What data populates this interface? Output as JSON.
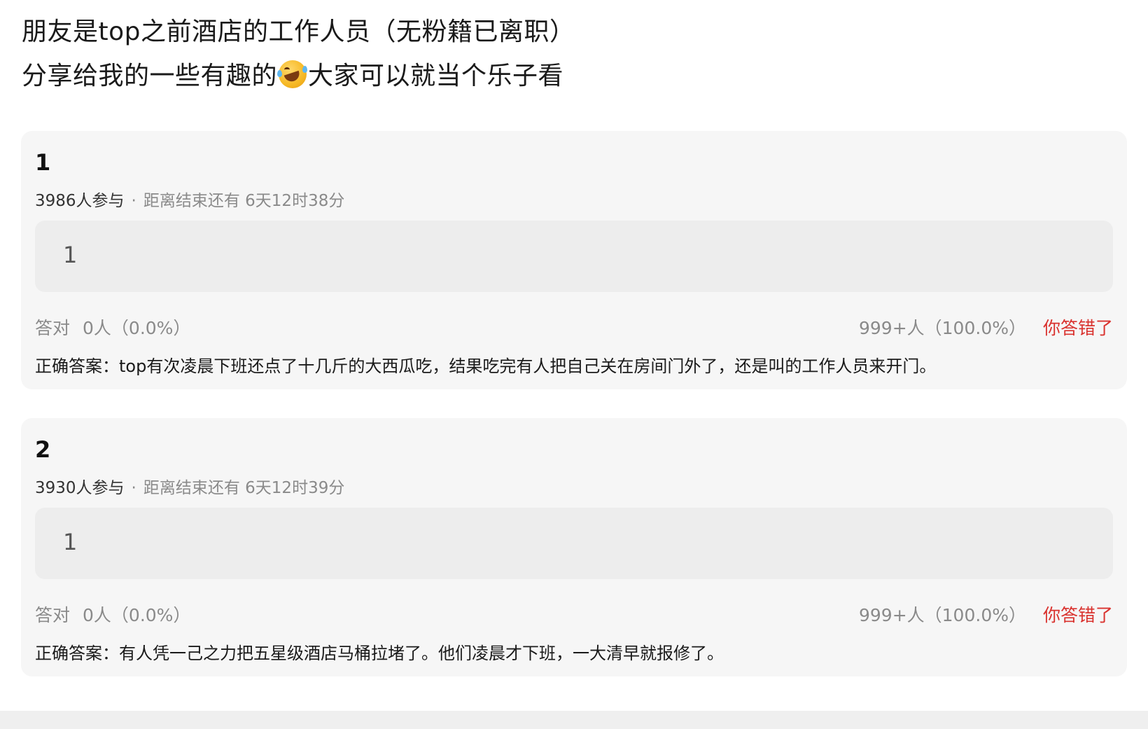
{
  "post": {
    "line1": "朋友是top之前酒店的工作人员（无粉籍已离职）",
    "line2_before": "分享给我的一些有趣的",
    "emoji_icon": "rolling-on-floor-laughing-emoji",
    "line2_after": "大家可以就当个乐子看"
  },
  "quizzes": [
    {
      "number": "1",
      "participants": "3986人参与",
      "separator": "·",
      "deadline": "距离结束还有 6天12时38分",
      "option": "1",
      "correct_label": "答对",
      "correct_count": "0人（0.0%）",
      "wrong_count": "999+人（100.0%）",
      "verdict": "你答错了",
      "answer": "正确答案：top有次凌晨下班还点了十几斤的大西瓜吃，结果吃完有人把自己关在房间门外了，还是叫的工作人员来开门。"
    },
    {
      "number": "2",
      "participants": "3930人参与",
      "separator": "·",
      "deadline": "距离结束还有 6天12时39分",
      "option": "1",
      "correct_label": "答对",
      "correct_count": "0人（0.0%）",
      "wrong_count": "999+人（100.0%）",
      "verdict": "你答错了",
      "answer": "正确答案：有人凭一己之力把五星级酒店马桶拉堵了。他们凌晨才下班，一大清早就报修了。"
    }
  ],
  "colors": {
    "card_bg": "#f6f6f6",
    "option_bg": "#ededed",
    "wrong_accent": "#d9322e",
    "muted_text": "#8a8a8a"
  }
}
